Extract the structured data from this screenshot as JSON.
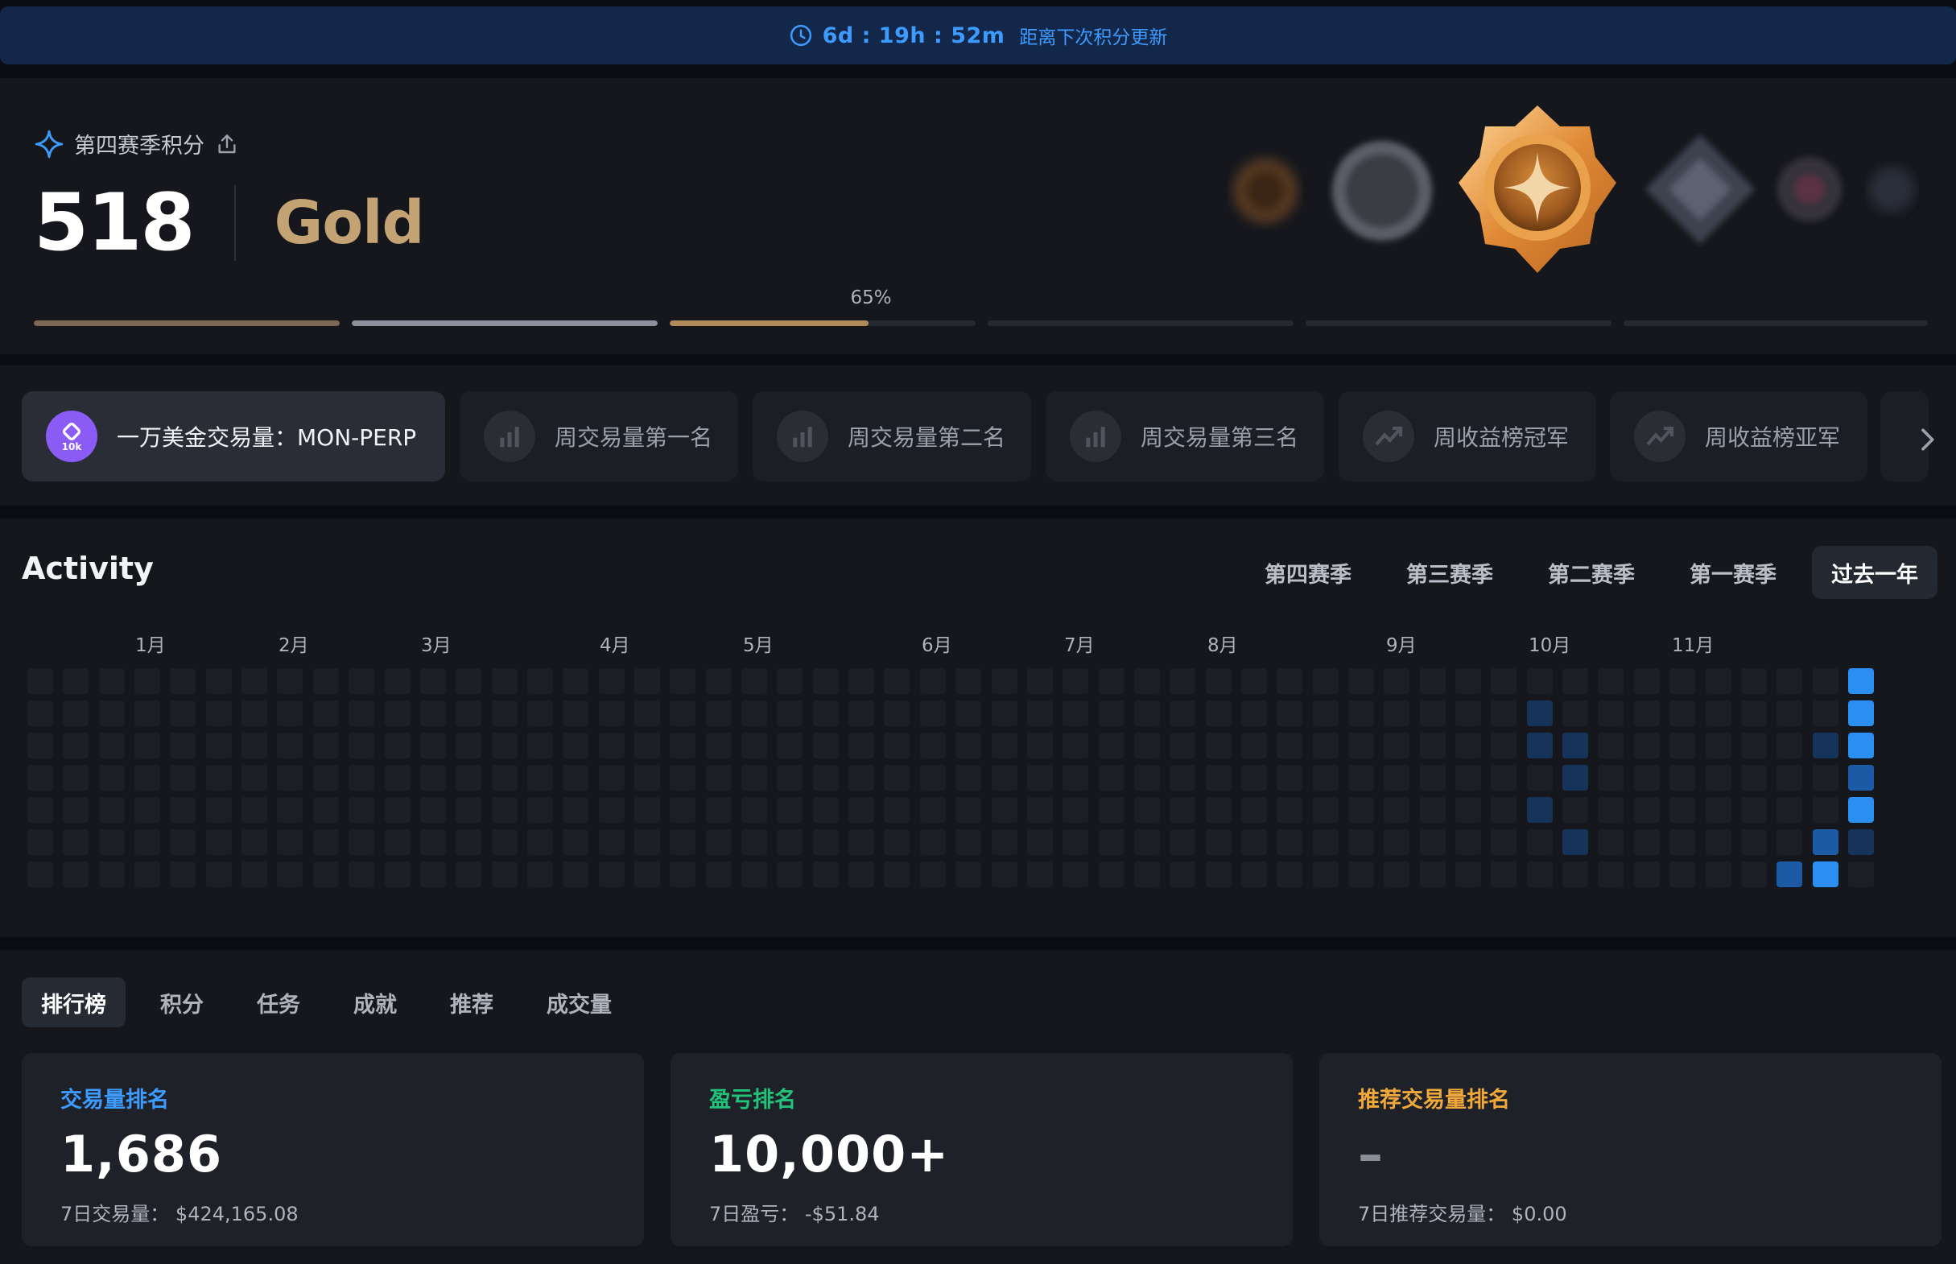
{
  "banner": {
    "countdown": "6d : 19h : 52m",
    "label": "距离下次积分更新"
  },
  "season": {
    "title": "第四赛季积分",
    "points": "518",
    "tier": "Gold",
    "progress_label": "65%",
    "progress_segments": [
      {
        "fill": 1.0,
        "color": "#7d6a55"
      },
      {
        "fill": 1.0,
        "color": "#8b909a"
      },
      {
        "fill": 0.65,
        "color": "#b08a57"
      },
      {
        "fill": 0.0,
        "color": "#252931"
      },
      {
        "fill": 0.0,
        "color": "#252931"
      },
      {
        "fill": 0.0,
        "color": "#252931"
      }
    ]
  },
  "badges": {
    "items": [
      {
        "label": "一万美金交易量：MON-PERP",
        "icon": "10k-badge-icon",
        "icon_text": "10k",
        "active": true
      },
      {
        "label": "周交易量第一名",
        "icon": "bar-chart-icon",
        "active": false
      },
      {
        "label": "周交易量第二名",
        "icon": "bar-chart-icon",
        "active": false
      },
      {
        "label": "周交易量第三名",
        "icon": "bar-chart-icon",
        "active": false
      },
      {
        "label": "周收益榜冠军",
        "icon": "trend-up-icon",
        "active": false
      },
      {
        "label": "周收益榜亚军",
        "icon": "trend-up-icon",
        "active": false
      }
    ]
  },
  "activity": {
    "title": "Activity",
    "seasons": [
      "第四赛季",
      "第三赛季",
      "第二赛季",
      "第一赛季",
      "过去一年"
    ],
    "selected": "过去一年",
    "months": [
      "1月",
      "2月",
      "3月",
      "4月",
      "5月",
      "6月",
      "7月",
      "8月",
      "9月",
      "10月",
      "11月"
    ],
    "colors": {
      "empty": "#1b1e24",
      "low": "#16345a",
      "mid": "#1d5aa6",
      "high": "#2b8ef0"
    }
  },
  "tabs": [
    "排行榜",
    "积分",
    "任务",
    "成就",
    "推荐",
    "成交量"
  ],
  "selected_tab": "排行榜",
  "rankings": [
    {
      "title": "交易量排名",
      "value": "1,686",
      "sub_label": "7日交易量：",
      "sub_value": "$424,165.08",
      "color": "#3d9bff"
    },
    {
      "title": "盈亏排名",
      "value": "10,000+",
      "sub_label": "7日盈亏：",
      "sub_value": "-$51.84",
      "color": "#22c27a"
    },
    {
      "title": "推荐交易量排名",
      "value": "–",
      "sub_label": "7日推荐交易量：",
      "sub_value": "$0.00",
      "color": "#f0a83a"
    }
  ]
}
